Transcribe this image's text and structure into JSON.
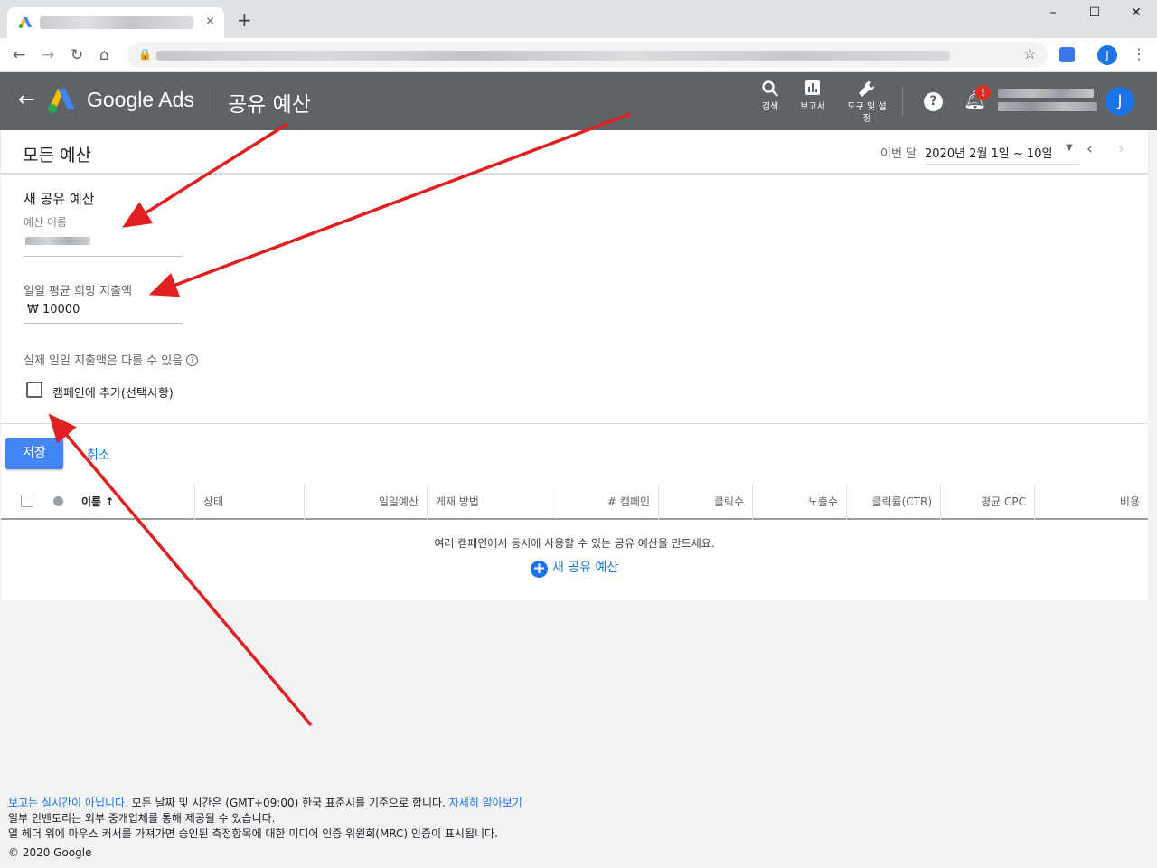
{
  "browser": {
    "tab_close": "×",
    "new_tab": "+",
    "window_controls": [
      "–",
      "☐",
      "✕"
    ],
    "profile_initial": "J"
  },
  "header": {
    "brand": "Google Ads",
    "page_title": "공유 예산",
    "actions": [
      {
        "label": "검색",
        "icon": "search-icon"
      },
      {
        "label": "보고서",
        "icon": "bar-chart-icon"
      },
      {
        "label": "도구 및 설정",
        "icon": "wrench-icon"
      }
    ],
    "notification_badge": "!",
    "avatar_initial": "J"
  },
  "subheader": {
    "title": "모든 예산",
    "date_range_label": "이번 달",
    "date_range_value": "2020년 2월 1일 ~ 10일"
  },
  "form": {
    "title": "새 공유 예산",
    "budget_name_label": "예산 이름",
    "daily_amount_label": "일일 평균 희망 지출액",
    "daily_amount_value": "₩ 10000",
    "note": "실제 일일 지출액은 다를 수 있음",
    "add_to_campaign_label": "캠페인에 추가(선택사항)",
    "save_label": "저장",
    "cancel_label": "취소"
  },
  "table": {
    "columns": [
      "이름",
      "상태",
      "일일예산",
      "게재 방법",
      "# 캠페인",
      "클릭수",
      "노출수",
      "클릭률(CTR)",
      "평균 CPC",
      "비용"
    ],
    "sort_indicator": "↑",
    "empty_message": "여러 캠페인에서 동시에 사용할 수 있는 공유 예산을 만드세요.",
    "create_link": "새 공유 예산"
  },
  "footer": {
    "line1_link": "보고는 실시간이 아닙니다.",
    "line1_text": " 모든 날짜 및 시간은 (GMT+09:00) 한국 표준시를 기준으로 합니다. ",
    "line1_more": "자세히 알아보기",
    "line2": "일부 인벤토리는 외부 중개업체를 통해 제공될 수 있습니다.",
    "line3": "열 헤더 위에 마우스 커서를 가져가면 승인된 측정항목에 대한 미디어 인증 위원회(MRC) 인증이 표시됩니다.",
    "copyright": "© 2020 Google"
  },
  "colors": {
    "header_bg": "#5f6368",
    "accent": "#1a73e8",
    "save_button": "#4285f4",
    "annotation_arrow": "#e02020"
  }
}
